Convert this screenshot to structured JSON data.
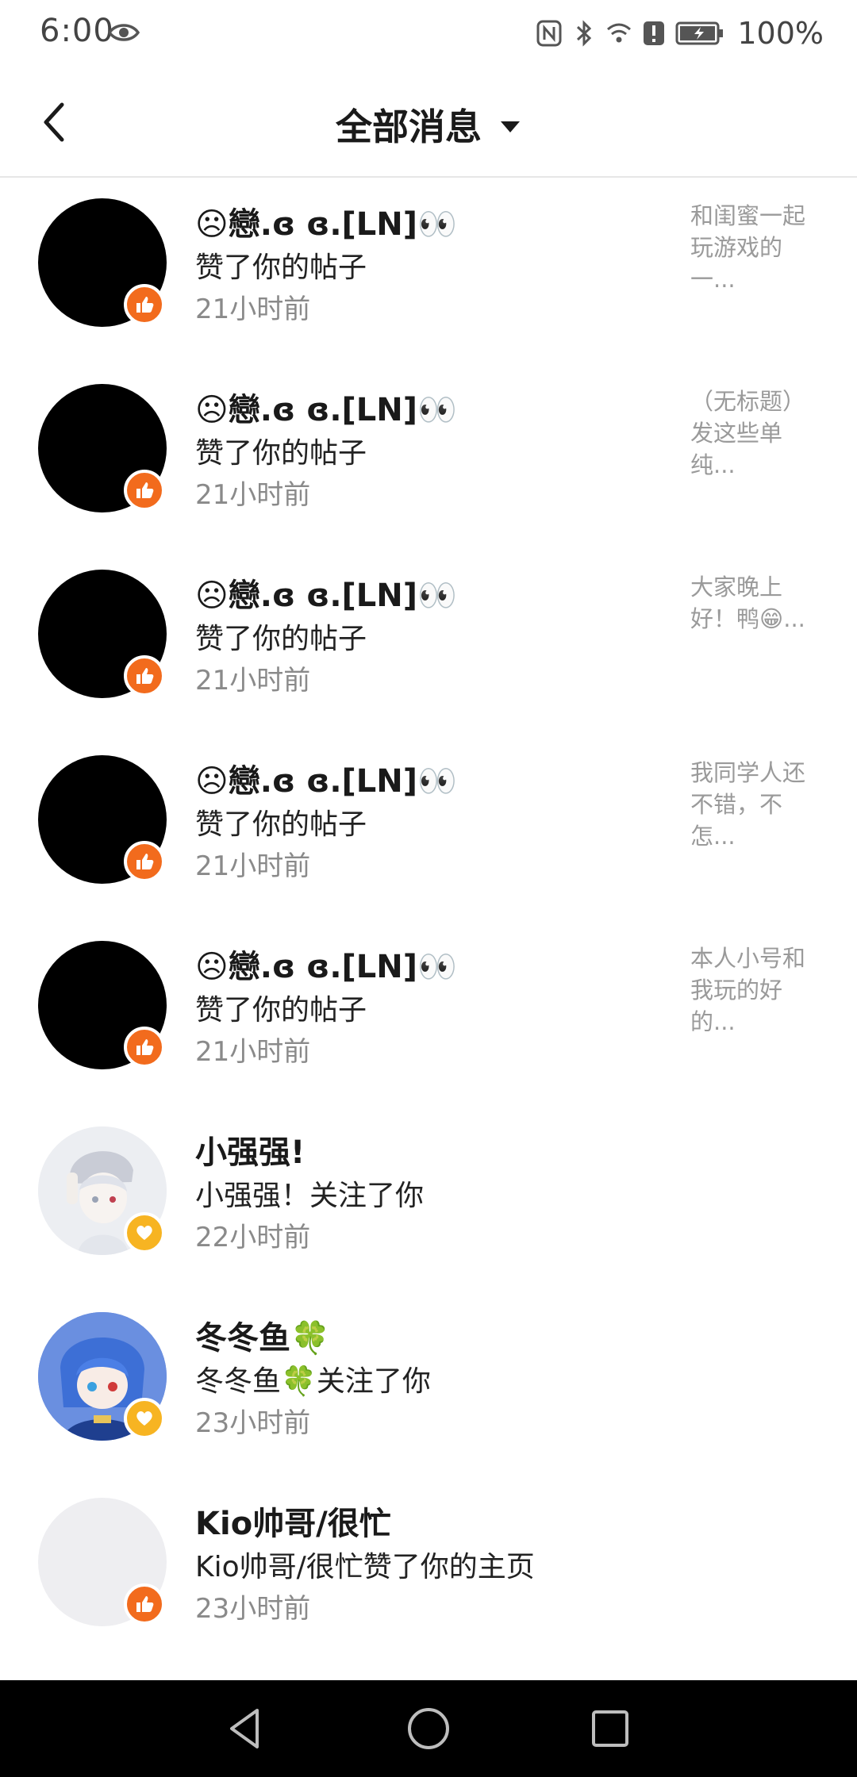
{
  "status_bar": {
    "time": "6:00",
    "battery": "100%",
    "icons": [
      "eye-icon",
      "nfc-icon",
      "bluetooth-icon",
      "wifi-icon",
      "alert-icon",
      "battery-icon"
    ]
  },
  "header": {
    "title": "全部消息",
    "back_icon": "chevron-left-icon",
    "dropdown_icon": "caret-down-icon"
  },
  "colors": {
    "like_badge": "#f26b1d",
    "follow_badge": "#f7b422",
    "secondary_text": "#8a8a8a"
  },
  "messages": [
    {
      "name": "☹戀.ɞ ɞ.[LN]👀",
      "action": "赞了你的帖子",
      "time": "21小时前",
      "preview": "和闺蜜一起玩游戏的一...",
      "badge": "like",
      "avatar": "black"
    },
    {
      "name": "☹戀.ɞ ɞ.[LN]👀",
      "action": "赞了你的帖子",
      "time": "21小时前",
      "preview": "（无标题）发这些单纯...",
      "badge": "like",
      "avatar": "black"
    },
    {
      "name": "☹戀.ɞ ɞ.[LN]👀",
      "action": "赞了你的帖子",
      "time": "21小时前",
      "preview": "大家晚上好！鸭😁...",
      "badge": "like",
      "avatar": "black"
    },
    {
      "name": "☹戀.ɞ ɞ.[LN]👀",
      "action": "赞了你的帖子",
      "time": "21小时前",
      "preview": "我同学人还不错，不怎...",
      "badge": "like",
      "avatar": "black"
    },
    {
      "name": "☹戀.ɞ ɞ.[LN]👀",
      "action": "赞了你的帖子",
      "time": "21小时前",
      "preview": "本人小号和我玩的好的...",
      "badge": "like",
      "avatar": "black"
    },
    {
      "name": "小强强!",
      "action": "小强强！关注了你",
      "time": "22小时前",
      "preview": "",
      "badge": "follow",
      "avatar": "anime-light"
    },
    {
      "name": "冬冬鱼🍀",
      "action": "冬冬鱼🍀关注了你",
      "time": "23小时前",
      "preview": "",
      "badge": "follow",
      "avatar": "anime-blue"
    },
    {
      "name": "Kio帅哥/很忙",
      "action": "Kio帅哥/很忙赞了你的主页",
      "time": "23小时前",
      "preview": "",
      "badge": "like",
      "avatar": "placeholder"
    }
  ],
  "nav_bar": {
    "buttons": [
      "back-triangle-icon",
      "home-circle-icon",
      "recents-square-icon"
    ]
  }
}
